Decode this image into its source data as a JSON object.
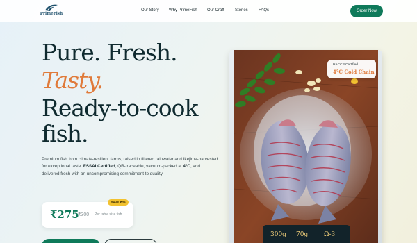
{
  "header": {
    "logo_text": "PrimeFish",
    "nav": [
      "Our Story",
      "Why PrimeFish",
      "Our Craft",
      "Stories",
      "FAQs"
    ],
    "order_button": "Order Now"
  },
  "hero": {
    "line1": "Pure. Fresh.",
    "line2": "Tasty.",
    "line3": "Ready-to-cook",
    "line4": "fish.",
    "desc_1": "Premium fish from climate-resilient farms, raised in filtered rainwater and Ikejime-harvested for exceptional taste. ",
    "desc_bold_1": "FSSAI Certified",
    "desc_2": ", QR-traceable, vacuum-packed at ",
    "desc_bold_2": "4°C",
    "desc_3": ", and delivered fresh with an uncompromising commitment to quality."
  },
  "pricing": {
    "save_badge": "SAVE ₹25",
    "price": "₹275",
    "old_price": "₹300",
    "per_size": "Per table size fish"
  },
  "product": {
    "haccp_label": "HACCP Certified",
    "cold_chain": "4°C Cold Chain",
    "stats": [
      "300g",
      "70g",
      "Ω-3"
    ]
  },
  "colors": {
    "brand_green": "#0f7a5a",
    "accent_orange": "#e07a3a",
    "badge_yellow": "#f2c230"
  }
}
